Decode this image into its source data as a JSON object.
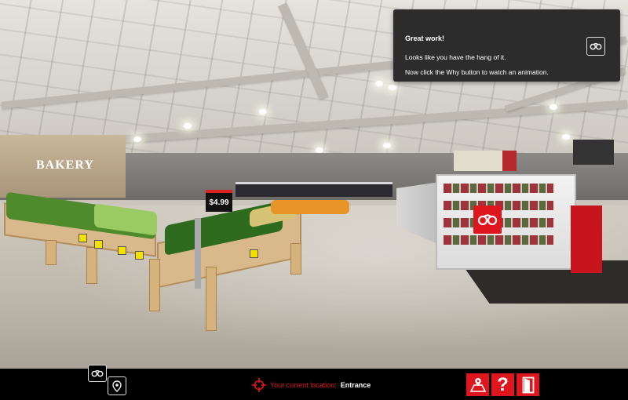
{
  "tooltip": {
    "title": "Great work!",
    "line1": "Looks like you have the hang of it.",
    "line2": "Now click the Why button to watch an animation.",
    "why_icon": "binoculars-icon"
  },
  "scene": {
    "bakery_sign": "BAKERY",
    "price_sign": "$4.99"
  },
  "hotspot": {
    "icon": "binoculars-icon"
  },
  "bottom_bar": {
    "location_label": "Your current location:",
    "location_value": "Entrance",
    "help_label": "?"
  },
  "colors": {
    "accent": "#e0161e",
    "panel": "#2c2c2c",
    "bar": "#000000"
  }
}
